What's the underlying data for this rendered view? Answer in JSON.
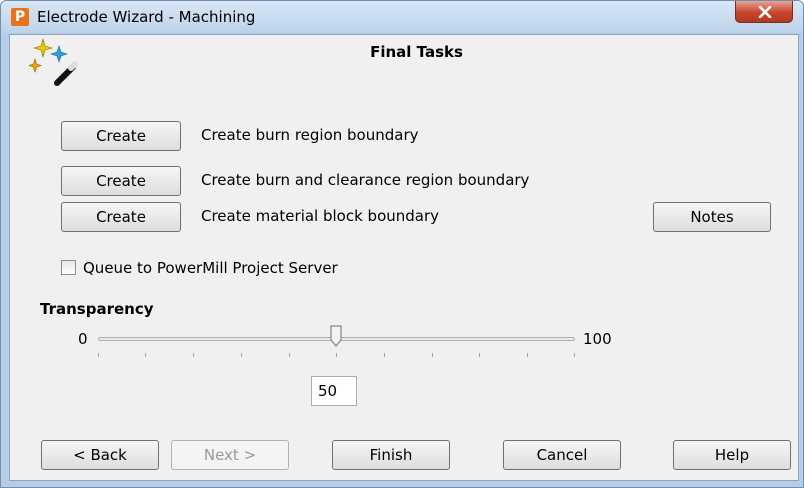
{
  "window": {
    "title": "Electrode Wizard - Machining",
    "app_icon": "P"
  },
  "main": {
    "heading": "Final Tasks",
    "tasks": [
      {
        "button": "Create",
        "label": "Create burn region boundary"
      },
      {
        "button": "Create",
        "label": "Create burn and clearance region boundary"
      },
      {
        "button": "Create",
        "label": "Create material block boundary"
      }
    ],
    "notes_button": "Notes",
    "queue_checkbox": {
      "label": "Queue to PowerMill Project Server",
      "checked": false
    },
    "transparency": {
      "title": "Transparency",
      "min_label": "0",
      "max_label": "100",
      "value": "50",
      "level": 0.5
    }
  },
  "footer": {
    "back": "< Back",
    "next": "Next >",
    "finish": "Finish",
    "cancel": "Cancel",
    "help": "Help"
  },
  "colors": {
    "title_bar": "#bcd2ea",
    "close_button": "#c7462b",
    "dialog_background": "#f0f0f0",
    "app_icon": "#e8731a"
  },
  "icons": [
    "app-logo-icon",
    "close-icon",
    "wizard-wand-icon",
    "slider-thumb-icon"
  ]
}
